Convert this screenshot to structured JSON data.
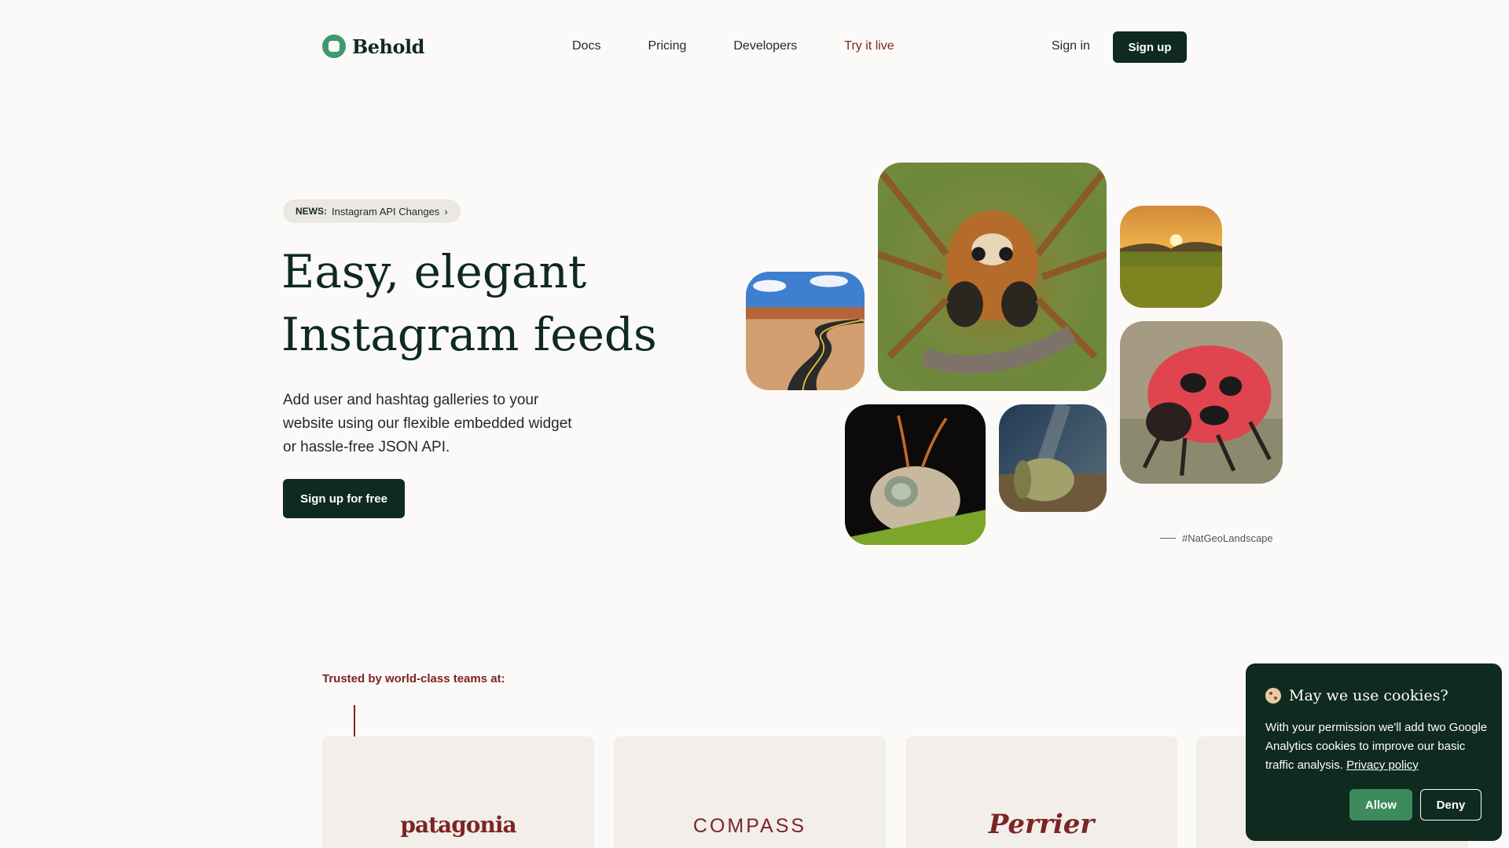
{
  "nav": {
    "logo_text": "Behold",
    "links": [
      "Docs",
      "Pricing",
      "Developers",
      "Try it live"
    ],
    "signin_label": "Sign in",
    "signup_label": "Sign up"
  },
  "hero": {
    "news_tag": "NEWS:",
    "news_text": "Instagram API Changes",
    "title_line1": "Easy, elegant",
    "title_line2": "Instagram feeds",
    "subtitle": "Add user and hashtag galleries to your website using our flexible embedded widget or hassle-free JSON API.",
    "cta_label": "Sign up for free",
    "hashtag": "#NatGeoLandscape"
  },
  "trusted": {
    "heading": "Trusted by world-class teams at:",
    "brands": [
      "patagonia",
      "COMPASS",
      "Perrier"
    ]
  },
  "cookie": {
    "title": "May we use cookies?",
    "text": "With your permission we'll add two Google Analytics cookies to improve our basic traffic analysis.",
    "link_label": "Privacy policy",
    "allow_label": "Allow",
    "deny_label": "Deny"
  },
  "colors": {
    "brand_dark": "#0f2a1e",
    "brand_green": "#3d9a6a",
    "accent_red": "#7d2424",
    "background": "#fbfaf8"
  },
  "icons": [
    "logo-mark-icon",
    "chevron-right-icon",
    "cookie-icon"
  ]
}
